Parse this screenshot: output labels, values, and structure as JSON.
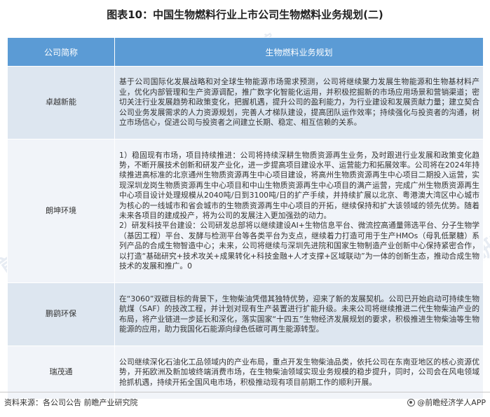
{
  "title": "图表10：中国生物燃料行业上市公司生物燃料业务规划(二)",
  "table": {
    "headers": [
      "公司简称",
      "生物燃料业务规划"
    ],
    "rows": [
      {
        "company": "卓越新能",
        "plan": "基于公司国际化发展战略和对全球生物能源市场需求预测，公司将继续聚力发展生物能源和生物基材料产业，优化内部管理和生产资源调配，推广数字化智能化运用，并积极挖掘新的市场应用场景和营销渠道；密切关注行业发展趋势和政策变化，把握机遇，提升公司的盈利能力，为行业建设和发展贡献力量；建立契合公司业务发展需求的人力资源规划，完善人才梯队建设，提高团队运作效率；持续强化与投资者的沟通，树立市场信心，促进公司与投资者之间建立长期、稳定、相互信赖的关系。"
      },
      {
        "company": "朗坤环境",
        "plan": "1）稳固现有市场，项目持续推进：公司将持续深耕生物质资源再生业务，及时跟进行业发展和政策变化趋势，不断开展技术创新和研发产业化，进一步提高项目建设水平、运营能力和拓展效率。公司将在2024年持续推进高标准的北京通州生物质资源再生中心项目建设，将高州生物质资源再生中心项目二期投入运营，实现深圳龙岗生物质资源再生中心项目和中山生物质资源再生中心项目的满产运营，完成广州生物质资源再生中心项目设计处理规模从2040吨/日到3100吨/日的扩产手续，并持续扩展以北京、粤港澳大湾区中心城市为核心的一线城市和省会城市的生物质资源再生中心项目的开拓，继续保持和扩大该领域的领先优势。随着未来各项目的建成投产，将为公司的发展注入更加强劲的动力。\n2）研发科技平台建设：公司研发总部将以继续建设AI+生物信息平台、微流控高通量筛选平台、分子生物学（基因工程）平台、发酵与检测平台等各类平台为支点，继续着力打造可用于生产HMOs（母乳低聚糖）系列产品的合成生物智造中心；未来，公司将继续与深圳先进院和国家生物制造产业创新中心保持紧密合作，以打造“基础研究+技术攻关+成果转化+科技金融+人才支撑+区域联动”为一体的创新生态，推动合成生物技术的发展和推广。0"
      },
      {
        "company": "鹏鹞环保",
        "plan": "在“3060”双碳目标的背景下，生物柴油凭借其独特优势，迎来了新的发展契机。公司已开始启动可持续生物航煤（SAF）的技改工程，并计划对现有生产装置进行扩能升级。未来公司将继续推进二代生物柴油产业的布局，将产业链进一步延长和深化，落实国家“十四五”生物经济发展规划的要求，积极推进生物柴油等生物能源的应用，助力我国化石能源向绿色低碳可再生能源转型。"
      },
      {
        "company": "瑞茂通",
        "plan": "公司继续深化石油化工品领域内的产业布局，重点开发生物柴油品类，依托公司在东南亚地区的核心资源优势，开拓欧洲及新加坡终端消费市场，在生物柴油领域实现业务规模的稳步提升，同时，公司会在风电领域抢抓机遇，持续开拓全国风电市场，积极推动现有项目前期工作的顺利开展。"
      }
    ]
  },
  "footer": {
    "source": "资料来源：各公司公告 前瞻产业研究院",
    "brand": "@前瞻经济学人APP"
  },
  "watermark": {
    "text": "前瞻产业研究院",
    "color": "#8aa4c8"
  },
  "colors": {
    "header_bg": "#5b9bd5",
    "row_odd": "#dde6f0",
    "row_even": "#f1f4f9"
  }
}
